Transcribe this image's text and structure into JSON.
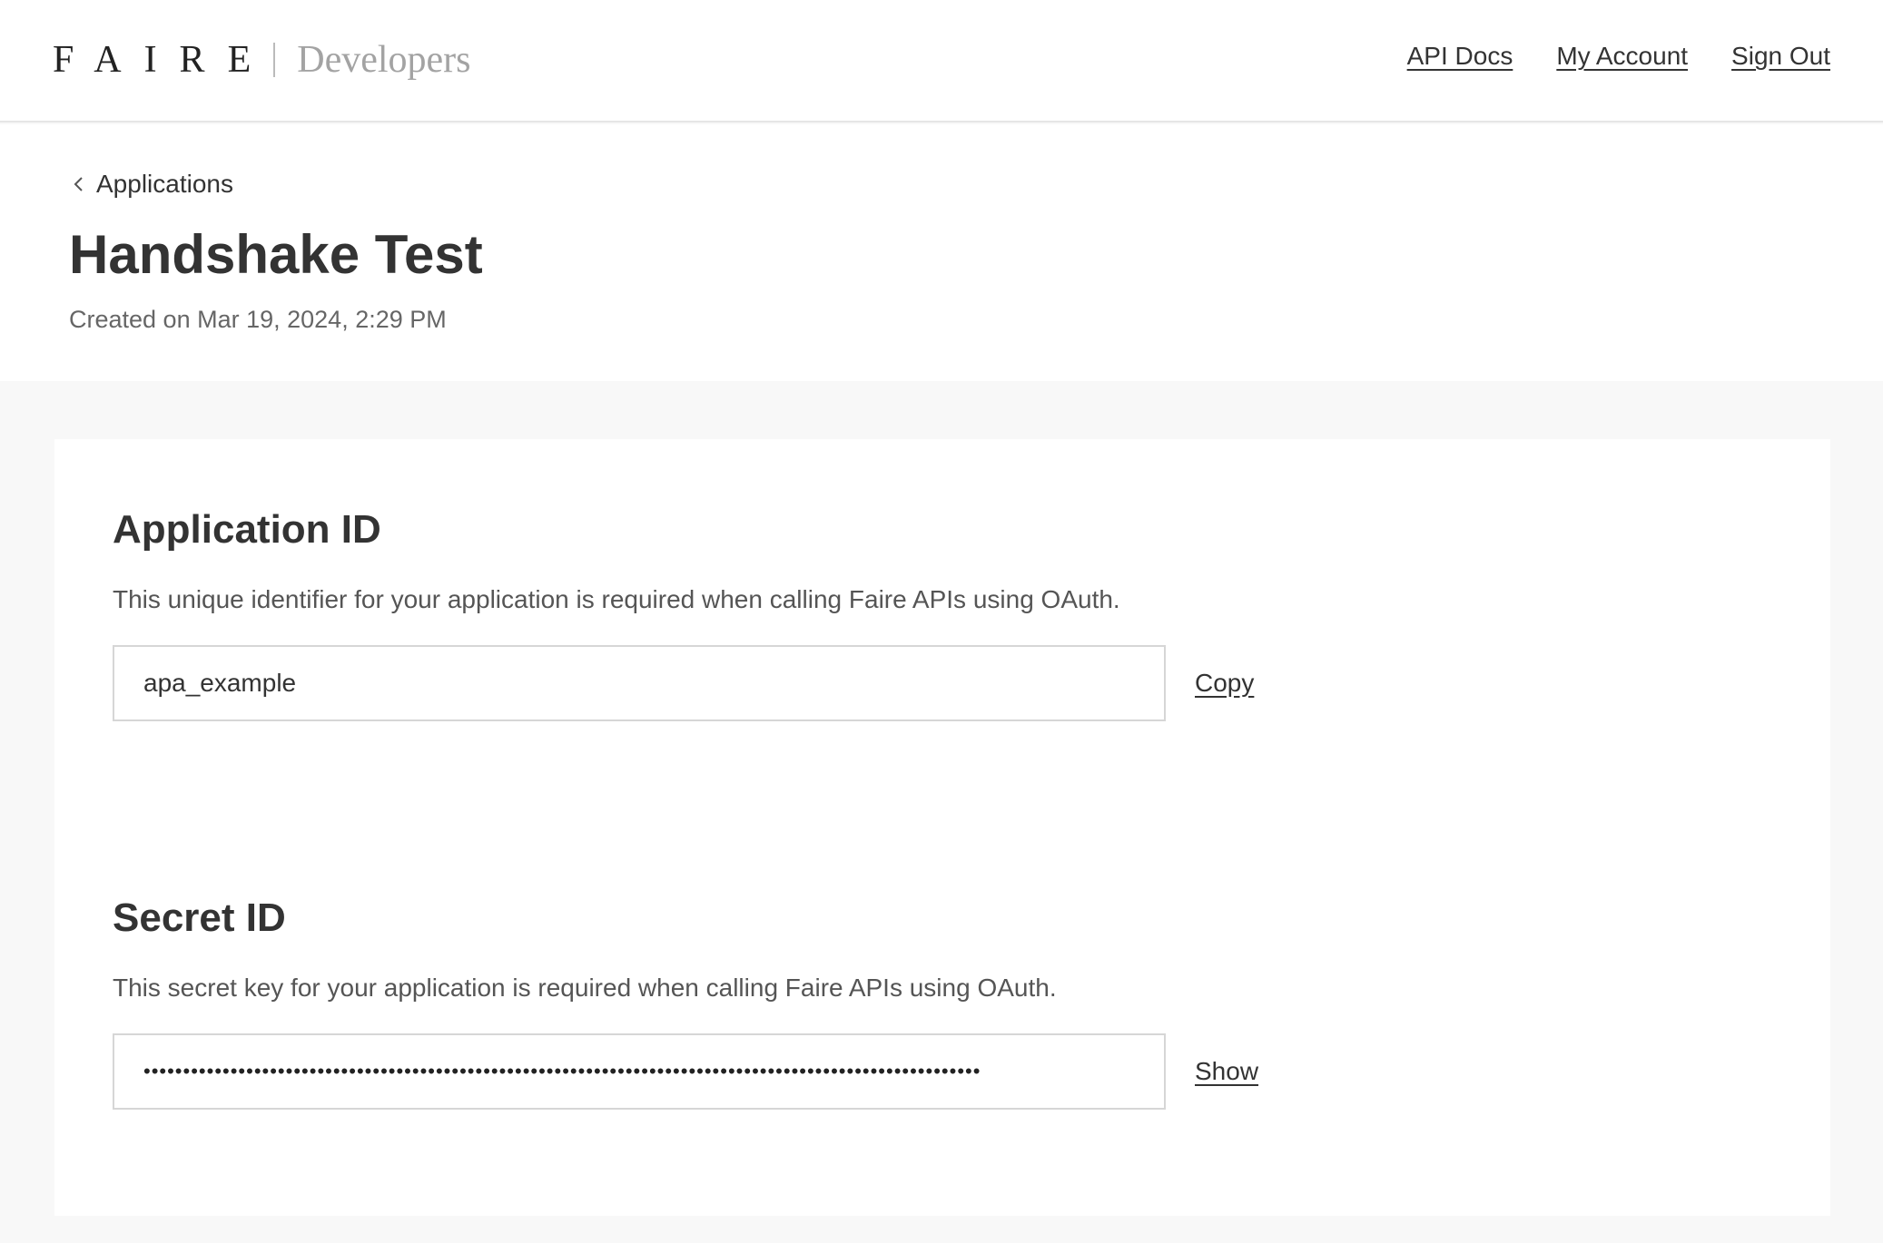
{
  "brand": {
    "logo": "FAIRE",
    "subtitle": "Developers"
  },
  "topnav": {
    "api_docs": "API Docs",
    "my_account": "My Account",
    "sign_out": "Sign Out"
  },
  "breadcrumb": {
    "label": "Applications",
    "icon": "chevron-left-icon"
  },
  "page": {
    "title": "Handshake Test",
    "created": "Created on Mar 19, 2024, 2:29 PM"
  },
  "application_id": {
    "heading": "Application ID",
    "description": "This unique identifier for your application is required when calling Faire APIs using OAuth.",
    "value": "apa_example",
    "action_label": "Copy"
  },
  "secret_id": {
    "heading": "Secret ID",
    "description": "This secret key for your application is required when calling Faire APIs using OAuth.",
    "value": "••••••••••••••••••••••••••••••••••••••••••••••••••••••••••••••••••••••••••••••••••••••••••••••••••••••••••",
    "action_label": "Show"
  },
  "colors": {
    "text": "#333333",
    "muted": "#666666",
    "background": "#f8f8f8",
    "card": "#ffffff",
    "border": "#d6d6d6"
  }
}
